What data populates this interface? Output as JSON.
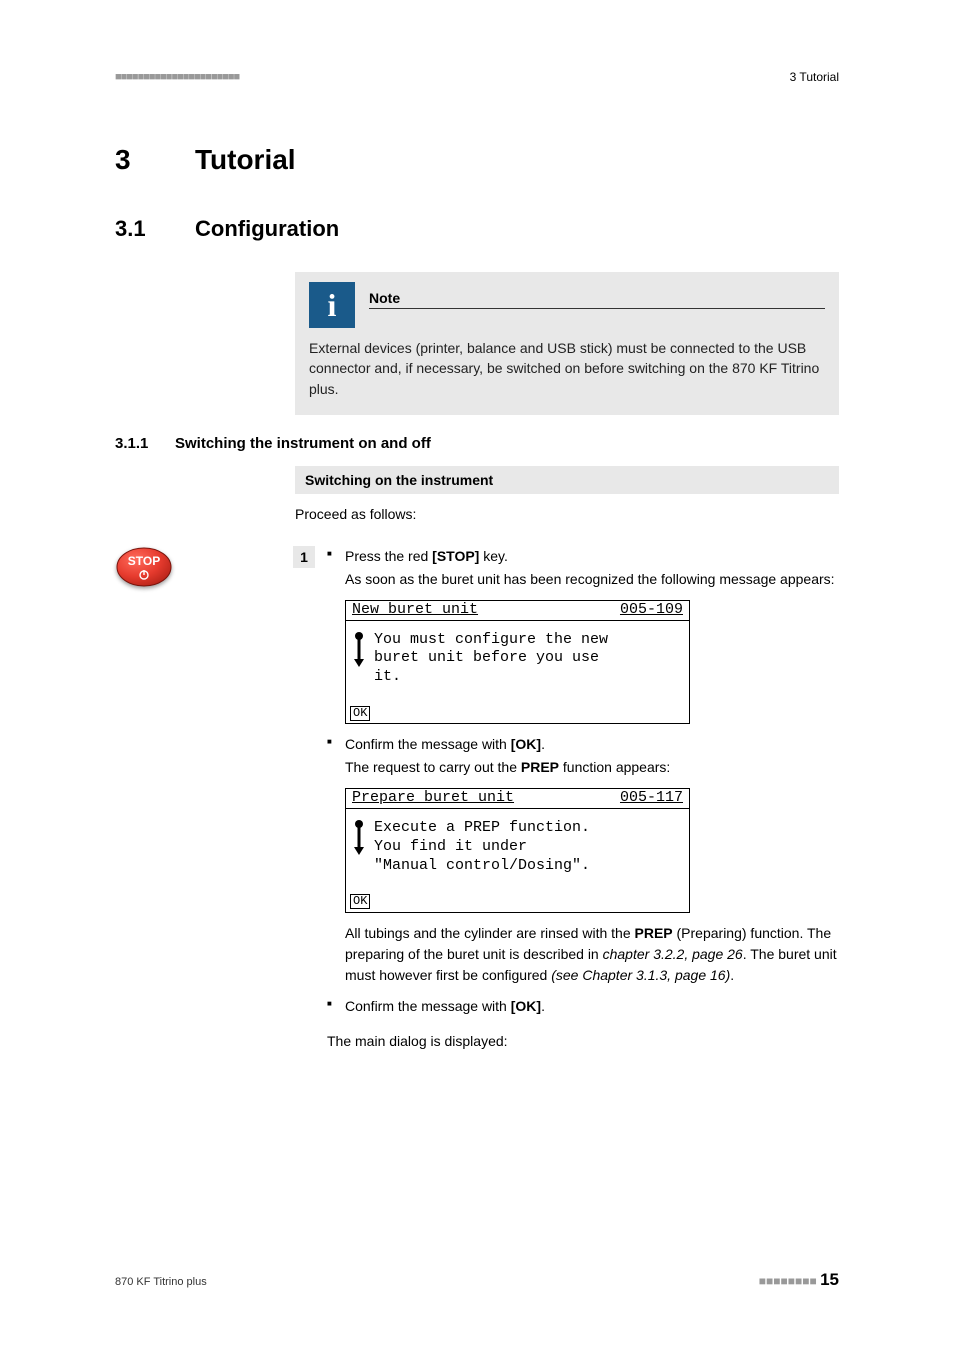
{
  "header": {
    "dashes_left": "■■■■■■■■■■■■■■■■■■■■■■",
    "right": "3 Tutorial"
  },
  "chapter": {
    "num": "3",
    "title": "Tutorial"
  },
  "section": {
    "num": "3.1",
    "title": "Configuration"
  },
  "note": {
    "label": "Note",
    "text": "External devices (printer, balance and USB stick) must be connected to the USB connector and, if necessary, be switched on before switching on the 870 KF Titrino plus."
  },
  "subsection": {
    "num": "3.1.1",
    "title": "Switching the instrument on and off"
  },
  "procedure_title": "Switching on the instrument",
  "proceed": "Proceed as follows:",
  "stop_label": "STOP",
  "step_num": "1",
  "bullets": {
    "b1_pre": "Press the red ",
    "b1_key": "[STOP]",
    "b1_post": " key.",
    "b1_sub": "As soon as the buret unit has been recognized the following message appears:",
    "b2_pre": "Confirm the message with ",
    "b2_key": "[OK]",
    "b2_post": ".",
    "b2_sub_pre": "The request to carry out the ",
    "b2_sub_key": "PREP",
    "b2_sub_post": " function appears:",
    "b3_para_1": "All tubings and the cylinder are rinsed with the ",
    "b3_para_key": "PREP",
    "b3_para_2": " (Preparing) function. The preparing of the buret unit is described in ",
    "b3_para_i1": "chapter 3.2.2, page 26",
    "b3_para_3": ". The buret unit must however first be configured ",
    "b3_para_i2": "(see Chapter 3.1.3, page 16)",
    "b3_para_4": ".",
    "b4_pre": "Confirm the message with ",
    "b4_key": "[OK]",
    "b4_post": "."
  },
  "lcd1": {
    "title": "New buret unit",
    "code": "005-109",
    "msg": "You must configure the new\nburet unit before you use\nit.",
    "ok": "OK"
  },
  "lcd2": {
    "title": "Prepare buret unit",
    "code": "005-117",
    "msg": "Execute a PREP function.\nYou find it under\n\"Manual control/Dosing\".",
    "ok": "OK"
  },
  "main_dialog": "The main dialog is displayed:",
  "footer": {
    "left": "870 KF Titrino plus",
    "dashes": "■■■■■■■■",
    "page": "15"
  }
}
